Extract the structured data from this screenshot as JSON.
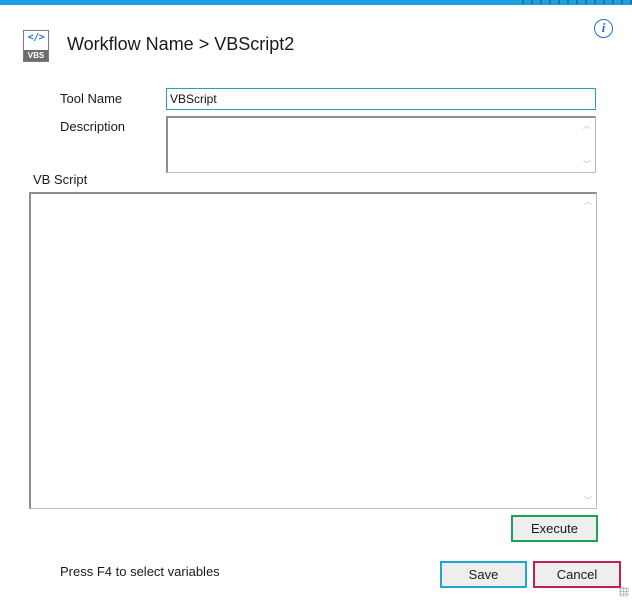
{
  "header": {
    "title": "Workflow Name > VBScript2",
    "icon_code": "</>",
    "icon_badge": "VBS"
  },
  "form": {
    "tool_name_label": "Tool Name",
    "tool_name_value": "VBScript",
    "description_label": "Description",
    "description_value": "",
    "vb_script_label": "VB Script",
    "vb_script_value": ""
  },
  "buttons": {
    "execute_label": "Execute",
    "save_label": "Save",
    "cancel_label": "Cancel"
  },
  "footer": {
    "hint": "Press F4 to select variables"
  },
  "colors": {
    "accent_bar": "#1ba1e2",
    "execute_border": "#1aa259",
    "save_border": "#21a5cc",
    "cancel_border": "#c41f52",
    "info_icon": "#1f6fd6"
  },
  "icons": {
    "info": "info-icon",
    "app": "vbs-script-icon",
    "scroll_up": "chevron-up-icon",
    "scroll_down": "chevron-down-icon"
  }
}
